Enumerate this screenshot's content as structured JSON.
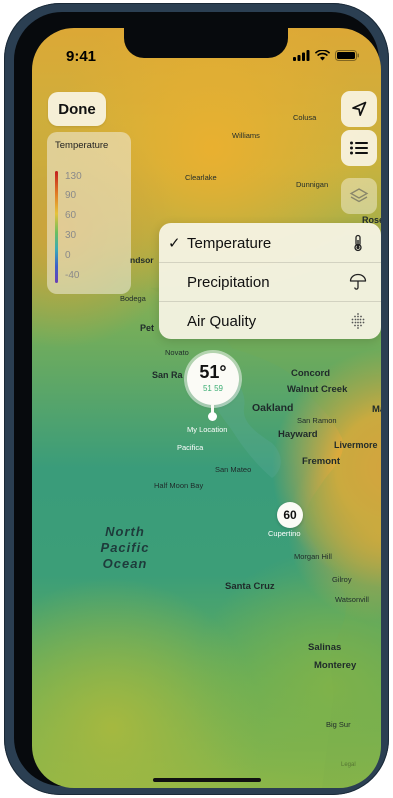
{
  "status_bar": {
    "time": "9:41"
  },
  "done_button": {
    "label": "Done"
  },
  "legend": {
    "title": "Temperature",
    "values": [
      "130",
      "90",
      "60",
      "30",
      "0",
      "-40"
    ]
  },
  "controls": {
    "location": "location-arrow-icon",
    "list": "list-icon",
    "layers": "layers-icon"
  },
  "menu": {
    "items": [
      {
        "label": "Temperature",
        "checked": true,
        "icon": "thermometer-icon"
      },
      {
        "label": "Precipitation",
        "checked": false,
        "icon": "umbrella-icon"
      },
      {
        "label": "Air Quality",
        "checked": false,
        "icon": "air-quality-icon"
      }
    ],
    "check_mark": "✓"
  },
  "map": {
    "places": {
      "williams": "Williams",
      "colusa": "Colusa",
      "clearlake": "Clearlake",
      "dunnigan": "Dunnigan",
      "rose": "Rose",
      "windsor": "ndsor",
      "bodega": "Bodega",
      "petaluma": "Pet",
      "novato": "Novato",
      "san_rafael": "San Ra",
      "concord": "Concord",
      "walnut_creek": "Walnut Creek",
      "oakland": "Oakland",
      "ma": "Ma",
      "san_ramon": "San Ramon",
      "hayward": "Hayward",
      "livermore": "Livermore",
      "fremont": "Fremont",
      "my_location": "My Location",
      "pacifica": "Pacifica",
      "san_mateo": "San Mateo",
      "half_moon_bay": "Half Moon Bay",
      "cupertino": "Cupertino",
      "morgan_hill": "Morgan Hill",
      "santa_cruz": "Santa Cruz",
      "gilroy": "Gilroy",
      "watsonville": "Watsonvill",
      "salinas": "Salinas",
      "monterey": "Monterey",
      "big_sur": "Big Sur"
    },
    "ocean_label": "North Pacific Ocean",
    "current": {
      "temp": "51°",
      "low": "51",
      "high": "59"
    },
    "cupertino_temp": "60",
    "legal": "Legal"
  }
}
